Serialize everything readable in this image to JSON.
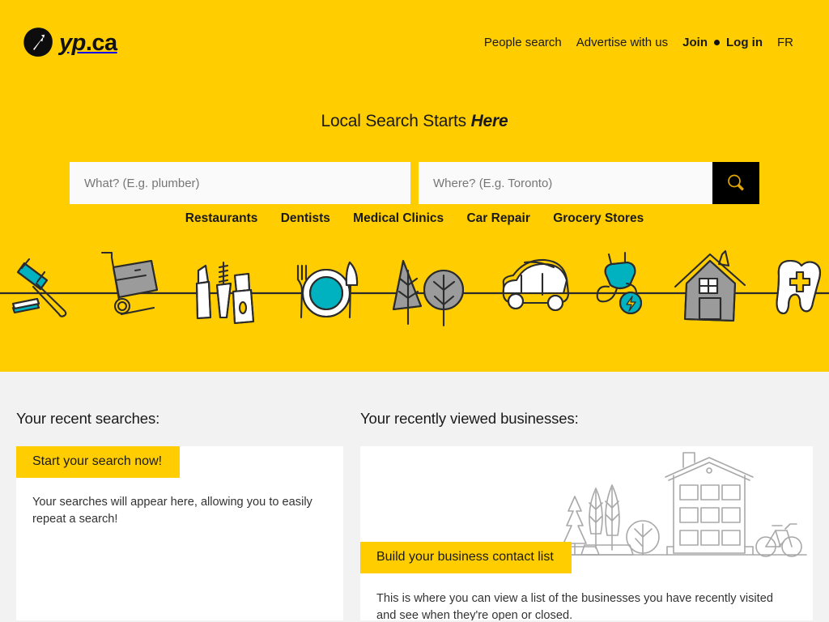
{
  "brand": {
    "logo_icon": "yp-arrow-logo-icon",
    "logo_text": "yp",
    "logo_suffix": ".ca",
    "yellow": "#ffcd00",
    "teal": "#00b2bf",
    "gray": "#8c8c8c",
    "ink": "#1a1a1a"
  },
  "nav": {
    "people_search": "People search",
    "advertise": "Advertise with us",
    "join": "Join",
    "login": "Log in",
    "lang": "FR"
  },
  "hero": {
    "tagline_prefix": "Local Search Starts ",
    "tagline_highlight": "Here",
    "search": {
      "what_placeholder": "What? (E.g. plumber)",
      "what_value": "",
      "where_placeholder": "Where? (E.g. Toronto)",
      "where_value": "",
      "button_icon": "search-icon"
    },
    "categories": [
      "Restaurants",
      "Dentists",
      "Medical Clinics",
      "Car Repair",
      "Grocery Stores"
    ],
    "illustration_items": [
      "gavel-icon",
      "hand-truck-icon",
      "cosmetics-icon",
      "plate-cutlery-icon",
      "trees-icon",
      "car-icon",
      "power-plug-icon",
      "house-icon",
      "tooth-icon"
    ]
  },
  "recent_searches": {
    "title": "Your recent searches:",
    "banner": "Start your search now!",
    "body": "Your searches will appear here, allowing you to easily repeat a search!"
  },
  "recent_businesses": {
    "title": "Your recently viewed businesses:",
    "banner": "Build your business contact list",
    "body": "This is where you can view a list of the businesses you have recently visited and see when they're open or closed.",
    "illustration": "city-street-building-icon"
  }
}
